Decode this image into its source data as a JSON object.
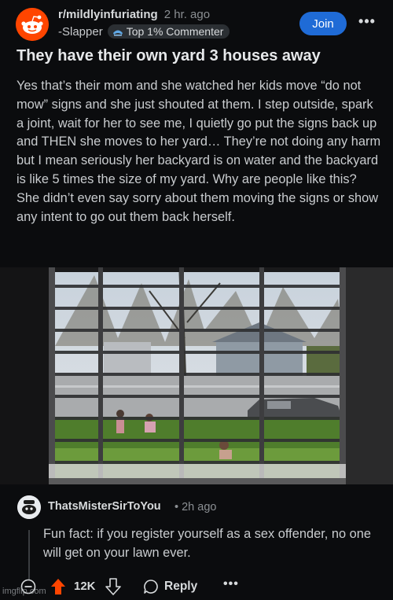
{
  "post": {
    "subreddit": "r/mildlyinfuriating",
    "age": "2 hr. ago",
    "author": "-Slapper",
    "flair": "Top 1% Commenter",
    "join_label": "Join",
    "more_icon": "ellipsis-icon",
    "title": "They have their own yard 3 houses away",
    "body": "Yes that’s their mom and she watched her kids move “do not mow” signs and she just shouted at them. I step outside, spark a joint, wait for her to see me, I quietly go put the signs back up and THEN she moves to her yard… They’re not doing any harm but I mean seriously her backyard is on water and the backyard is like 5 times the size of my yard. Why are people like this? She didn’t even say sorry about them moving the signs or show any intent to go out them back herself."
  },
  "comment": {
    "author": "ThatsMisterSirToYou",
    "age": "2h ago",
    "text": "Fun fact: if you register yourself as a sex offender, no one will get on your lawn ever.",
    "votes": "12K",
    "reply_label": "Reply"
  },
  "watermark": "imgflip.com",
  "colors": {
    "background": "#0b0c0e",
    "join_button": "#1f6bd6",
    "upvote": "#ff4500",
    "text": "#d7dadc",
    "muted": "#8b8f93"
  }
}
